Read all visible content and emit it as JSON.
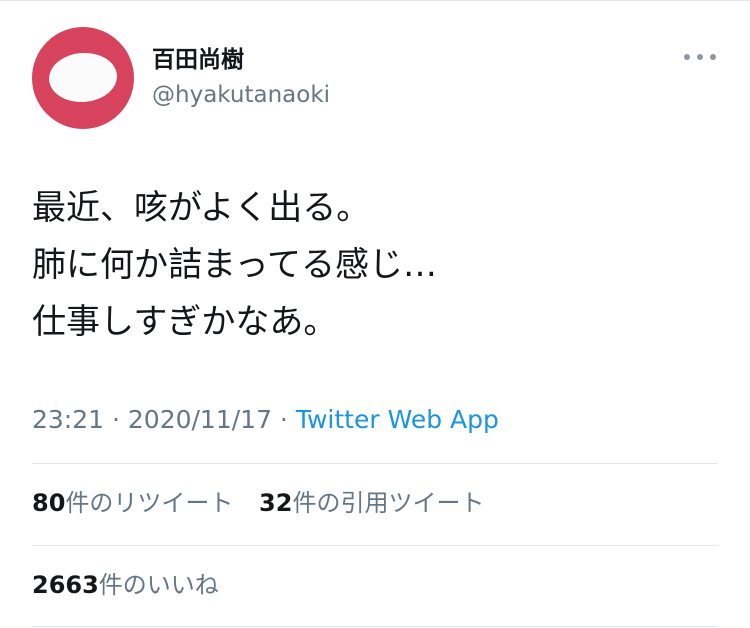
{
  "author": {
    "display_name": "百田尚樹",
    "handle": "@hyakutanaoki"
  },
  "tweet": {
    "lines": [
      "最近、咳がよく出る。",
      "肺に何か詰まってる感じ…",
      "仕事しすぎかなあ。"
    ]
  },
  "meta": {
    "time": "23:21",
    "separator": " · ",
    "date": "2020/11/17",
    "source": "Twitter Web App"
  },
  "stats": {
    "retweets": {
      "count": "80",
      "label": "件のリツイート"
    },
    "quotes": {
      "count": "32",
      "label": "件の引用ツイート"
    },
    "likes": {
      "count": "2663",
      "label": "件のいいね"
    }
  },
  "icons": {
    "more": "more-horizontal-icon"
  },
  "colors": {
    "avatar": "#d7435c",
    "link": "#1b95e0",
    "secondary_text": "#657786",
    "divider": "#e1e8ed"
  }
}
